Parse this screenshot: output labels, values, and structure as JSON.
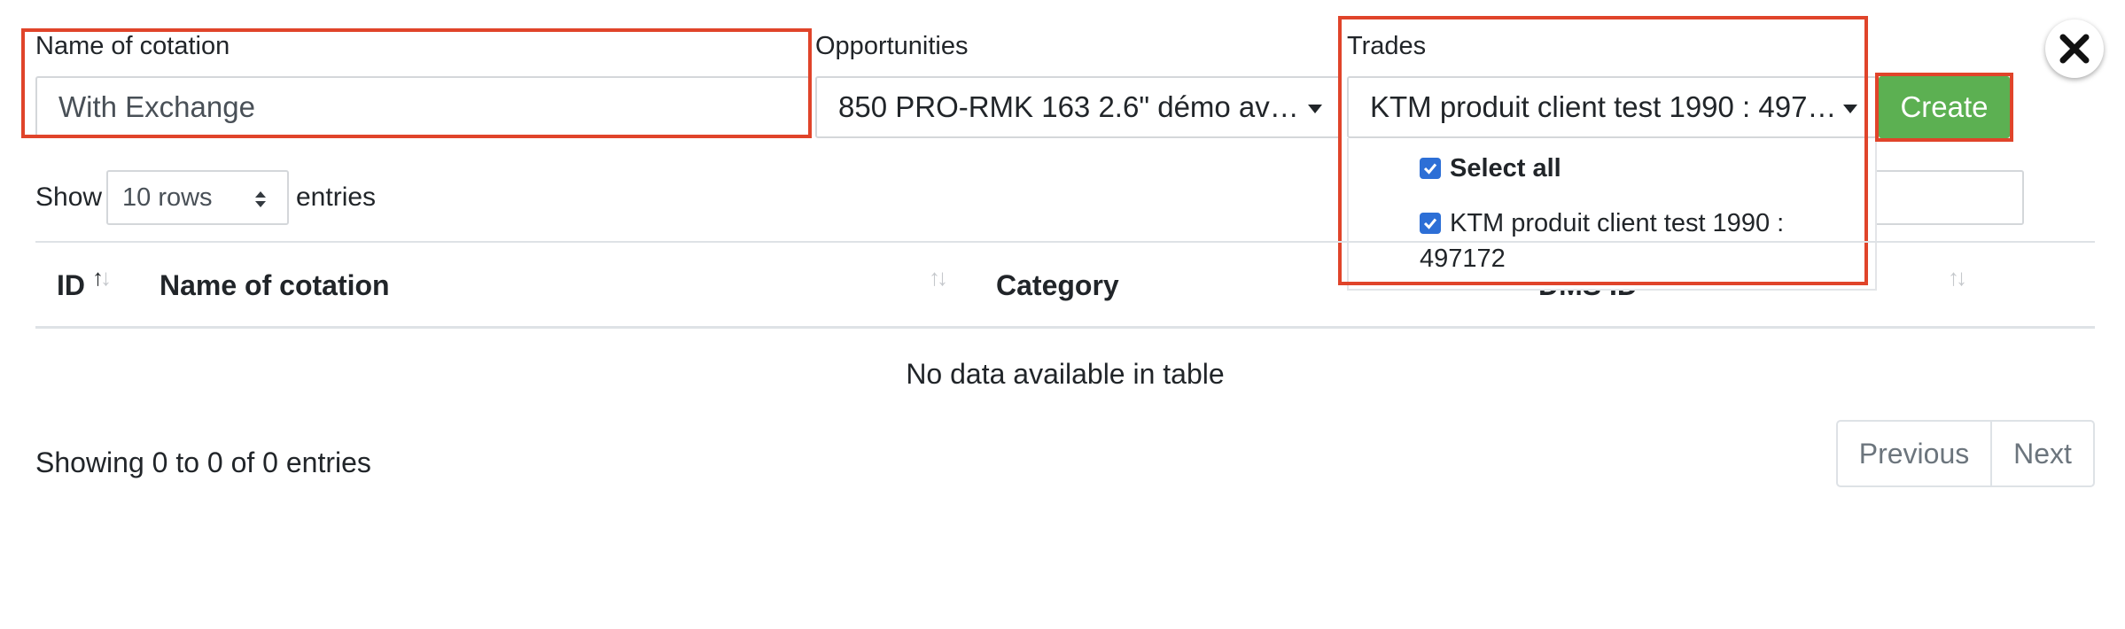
{
  "form": {
    "name_label": "Name of cotation",
    "name_value": "With Exchange",
    "opportunities_label": "Opportunities",
    "opportunities_value": "850 PRO-RMK 163 2.6\" démo av…",
    "trades_label": "Trades",
    "trades_value": "KTM produit client test 1990 : 497…",
    "create_label": "Create"
  },
  "trades_dropdown": {
    "select_all_label": "Select all",
    "select_all_checked": true,
    "options": [
      {
        "label_line1": "KTM produit client test 1990 :",
        "label_line2": "497172",
        "checked": true
      }
    ]
  },
  "table_controls": {
    "show_label": "Show",
    "rows_value": "10 rows",
    "entries_label": "entries"
  },
  "table": {
    "columns": [
      {
        "label": "ID",
        "sort": "asc"
      },
      {
        "label": "Name of cotation",
        "sort": "none"
      },
      {
        "label": "Category",
        "sort": "none"
      },
      {
        "label": "DMS ID",
        "sort": "none"
      }
    ],
    "empty_message": "No data available in table"
  },
  "footer": {
    "info": "Showing 0 to 0 of 0 entries",
    "previous_label": "Previous",
    "next_label": "Next"
  },
  "colors": {
    "highlight_red": "#e0442a",
    "create_green": "#5cb052",
    "checkbox_blue": "#2d6fd6"
  },
  "icons": {
    "close": "close-icon",
    "caret": "caret-down-icon",
    "rows_stepper": "sort-updown-icon",
    "checkbox": "checkbox-checked-icon"
  }
}
